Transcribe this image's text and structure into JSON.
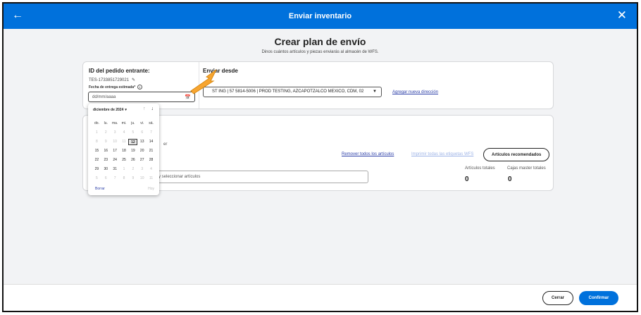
{
  "header": {
    "title": "Enviar inventario",
    "back_icon": "arrow-left-icon",
    "close_icon": "close-icon"
  },
  "page": {
    "title": "Crear plan de envío",
    "subtitle": "Dinos cuántos artículos y piezas enviarás al almacén de WFS."
  },
  "order": {
    "label": "ID del pedido entrante:",
    "id": "TES-1733851729021",
    "delivery_label": "Fecha de entrega estimada*",
    "date_placeholder": "dd/mm/aaaa"
  },
  "ship_from": {
    "label": "Enviar desde",
    "address": "ST ING | 57 5814-5006 | PROD TESTING, AZCAPOTZALCO MEXICO, CDM, 02",
    "new_address_link": "Agregar nueva dirección"
  },
  "items": {
    "hint": "er",
    "remove_all": "Remover todos los artículos",
    "print_labels": "Imprimir todas las etiquetas WFS",
    "recommended_button": "Artículos recomendados",
    "search_placeholder": "y seleccionar artículos",
    "total_items_label": "Artículos totales",
    "total_items_value": "0",
    "total_boxes_label": "Cajas master totales",
    "total_boxes_value": "0"
  },
  "calendar": {
    "month_label": "diciembre de 2024",
    "weekdays": [
      "do.",
      "lu.",
      "ma.",
      "mi.",
      "ju.",
      "vi.",
      "sá."
    ],
    "days": [
      {
        "n": "1",
        "m": true
      },
      {
        "n": "2",
        "m": true
      },
      {
        "n": "3",
        "m": true
      },
      {
        "n": "4",
        "m": true
      },
      {
        "n": "5",
        "m": true
      },
      {
        "n": "6",
        "m": true
      },
      {
        "n": "7",
        "m": true
      },
      {
        "n": "8",
        "m": true
      },
      {
        "n": "9",
        "m": true
      },
      {
        "n": "10",
        "m": true
      },
      {
        "n": "11",
        "m": true
      },
      {
        "n": "12",
        "m": false,
        "today": true
      },
      {
        "n": "13",
        "m": false
      },
      {
        "n": "14",
        "m": false
      },
      {
        "n": "15",
        "m": false
      },
      {
        "n": "16",
        "m": false
      },
      {
        "n": "17",
        "m": false
      },
      {
        "n": "18",
        "m": false
      },
      {
        "n": "19",
        "m": false
      },
      {
        "n": "20",
        "m": false
      },
      {
        "n": "21",
        "m": false
      },
      {
        "n": "22",
        "m": false
      },
      {
        "n": "23",
        "m": false
      },
      {
        "n": "24",
        "m": false
      },
      {
        "n": "25",
        "m": false
      },
      {
        "n": "26",
        "m": false
      },
      {
        "n": "27",
        "m": false
      },
      {
        "n": "28",
        "m": false
      },
      {
        "n": "29",
        "m": false
      },
      {
        "n": "30",
        "m": false
      },
      {
        "n": "31",
        "m": false
      },
      {
        "n": "1",
        "m": true
      },
      {
        "n": "2",
        "m": true
      },
      {
        "n": "3",
        "m": true
      },
      {
        "n": "4",
        "m": true
      },
      {
        "n": "5",
        "m": true
      },
      {
        "n": "6",
        "m": true
      },
      {
        "n": "7",
        "m": true
      },
      {
        "n": "8",
        "m": true
      },
      {
        "n": "9",
        "m": true
      },
      {
        "n": "10",
        "m": true
      },
      {
        "n": "11",
        "m": true
      }
    ],
    "clear_label": "Borrar",
    "today_label": "Hoy"
  },
  "footer": {
    "cancel_label": "Cerrar",
    "confirm_label": "Confirmar"
  },
  "colors": {
    "brand_blue": "#0071dc",
    "link_blue": "#2c3fa8",
    "pointer_orange": "#f7a531"
  }
}
